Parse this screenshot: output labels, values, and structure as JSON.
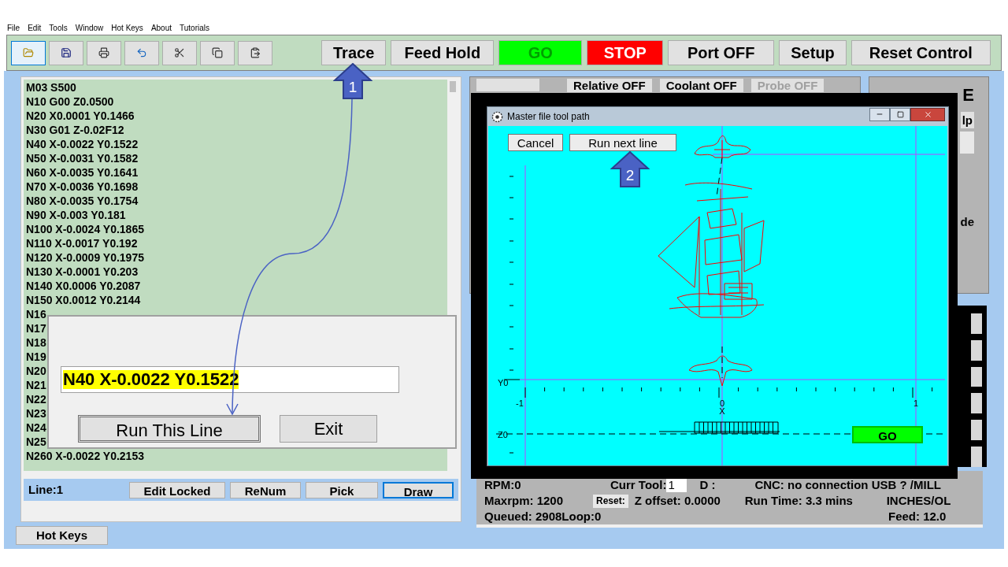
{
  "menu": [
    "File",
    "Edit",
    "Tools",
    "Window",
    "Hot Keys",
    "About",
    "Tutorials"
  ],
  "toolbar": {
    "icon_buttons": [
      {
        "selected": true
      },
      {
        "selected": false
      },
      {
        "selected": false
      },
      {
        "selected": false
      },
      {
        "selected": false
      },
      {
        "selected": false
      },
      {
        "selected": false
      }
    ],
    "buttons": [
      {
        "label": "Trace",
        "kind": "plain"
      },
      {
        "label": "Feed Hold",
        "kind": "plain"
      },
      {
        "label": "GO",
        "kind": "go"
      },
      {
        "label": "STOP",
        "kind": "stop"
      },
      {
        "label": "Port OFF",
        "kind": "plain"
      },
      {
        "label": "Setup",
        "kind": "plain"
      },
      {
        "label": "Reset Control",
        "kind": "plain"
      }
    ]
  },
  "code_list": {
    "lines": [
      "M03 S500",
      "N10 G00 Z0.0500",
      "N20 X0.0001 Y0.1466",
      "N30 G01 Z-0.02F12",
      "N40 X-0.0022 Y0.1522",
      "N50 X-0.0031 Y0.1582",
      "N60 X-0.0035 Y0.1641",
      "N70 X-0.0036 Y0.1698",
      "N80 X-0.0035 Y0.1754",
      "N90 X-0.003 Y0.181",
      "N100 X-0.0024 Y0.1865",
      "N110 X-0.0017 Y0.192",
      "N120 X-0.0009 Y0.1975",
      "N130 X-0.0001 Y0.203",
      "N140 X0.0006 Y0.2087",
      "N150 X0.0012 Y0.2144",
      "N16",
      "N17",
      "N18",
      "N19",
      "N20",
      "N21",
      "N22",
      "N23",
      "N24",
      "N25",
      "N260 X-0.0022 Y0.2153"
    ]
  },
  "bottom_bar": {
    "line": "Line:1",
    "buttons": [
      {
        "label": "Edit Locked",
        "selected": false
      },
      {
        "label": "ReNum",
        "selected": false
      },
      {
        "label": "Pick",
        "selected": false
      },
      {
        "label": "Draw",
        "selected": true
      }
    ]
  },
  "hot_keys": "Hot Keys",
  "control_panel": {
    "buttons": [
      {
        "label": "Relative OFF",
        "disabled": false
      },
      {
        "label": "Coolant OFF",
        "disabled": false
      },
      {
        "label": "Probe OFF",
        "disabled": true
      }
    ]
  },
  "side_panel": {
    "heading": "E",
    "button": "lp",
    "label": "de"
  },
  "status": {
    "rpm": "RPM:0",
    "tool_label": "Curr Tool:",
    "tool_value": "1",
    "d": "D :",
    "cnc": "CNC: no connection USB ? /MILL",
    "maxrpm": "Maxrpm: 1200",
    "reset": "Reset:",
    "z_offset": "Z offset: 0.0000",
    "run_time": "Run Time: 3.3 mins",
    "units": "INCHES/OL",
    "queued": "Queued: 2908Loop:0",
    "feed": "Feed: 12.0"
  },
  "line_dialog": {
    "value": "N40 X-0.0022 Y0.1522",
    "value_selected": true,
    "buttons": [
      {
        "label": "Run This Line",
        "default": true
      },
      {
        "label": "Exit",
        "default": false
      }
    ]
  },
  "toolpath_window": {
    "title": "Master file tool path",
    "buttons": [
      "Cancel",
      "Run next line"
    ],
    "y_label": "Y0",
    "z_label": "Z0",
    "x_label": "X",
    "x_ticks": [
      "-1",
      "0",
      "1"
    ],
    "go": "GO"
  },
  "callouts": [
    {
      "label": "1"
    },
    {
      "label": "2"
    }
  ]
}
